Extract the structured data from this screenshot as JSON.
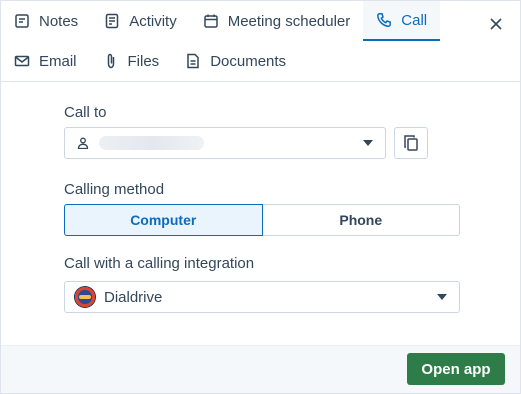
{
  "tabs_row1": [
    {
      "label": "Notes",
      "icon": "notes-icon",
      "active": false
    },
    {
      "label": "Activity",
      "icon": "activity-icon",
      "active": false
    },
    {
      "label": "Meeting scheduler",
      "icon": "calendar-icon",
      "active": false
    },
    {
      "label": "Call",
      "icon": "phone-icon",
      "active": true
    }
  ],
  "tabs_row2": [
    {
      "label": "Email",
      "icon": "email-icon"
    },
    {
      "label": "Files",
      "icon": "paperclip-icon"
    },
    {
      "label": "Documents",
      "icon": "document-icon"
    }
  ],
  "call_to": {
    "label": "Call to",
    "value_redacted": true
  },
  "calling_method": {
    "label": "Calling method",
    "options": [
      "Computer",
      "Phone"
    ],
    "selected": "Computer"
  },
  "integration": {
    "label": "Call with a calling integration",
    "selected": "Dialdrive"
  },
  "footer": {
    "open_app_label": "Open app"
  },
  "colors": {
    "accent": "#0c6bbf",
    "primary_button": "#2e7d49",
    "text": "#33475b",
    "border": "#cbd6e2"
  }
}
